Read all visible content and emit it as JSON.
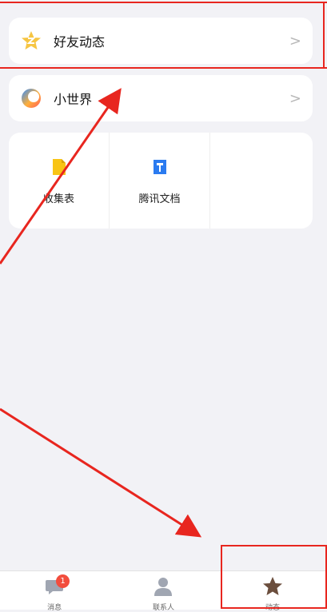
{
  "rows": [
    {
      "label": "好友动态",
      "chevron": ">"
    },
    {
      "label": "小世界",
      "chevron": ">"
    }
  ],
  "tools": [
    {
      "label": "收集表"
    },
    {
      "label": "腾讯文档"
    }
  ],
  "tabbar": {
    "messages": {
      "label": "消息",
      "badge": "1"
    },
    "contacts": {
      "label": "联系人"
    },
    "feed": {
      "label": "动态"
    }
  },
  "colors": {
    "background": "#f2f2f6",
    "annotation": "#e8261f",
    "badge": "#f24d3d",
    "feed_tab_active": "#6b4e3d",
    "inactive_tab": "#a0a6b2"
  }
}
